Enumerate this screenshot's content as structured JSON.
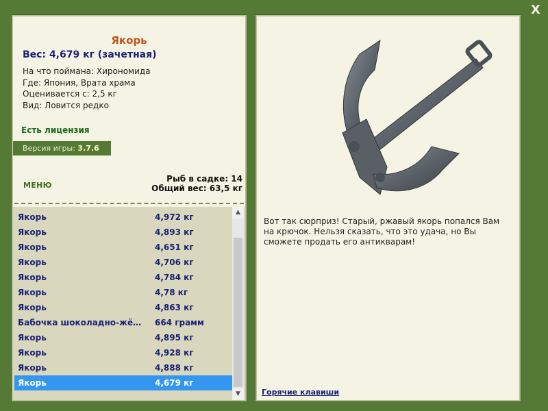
{
  "close_label": "X",
  "fish": {
    "title": "Якорь",
    "weight_line": "Вес: 4,679 кг (зачетная)",
    "info": [
      "На что поймана: Хирономида",
      "Где: Япония, Врата храма",
      "Оценивается с: 2,5 кг",
      "Вид: Ловится редко"
    ],
    "description": "Вот так сюрприз! Старый, ржавый якорь попался Вам на крючок. Нельзя сказать, что это удача, но Вы сможете продать его антикварам!",
    "image": "anchor-image"
  },
  "license": "Есть лицензия",
  "version": {
    "label": "Версия игры:",
    "value": "3.7.6"
  },
  "menu_label": "МЕНЮ",
  "stats": {
    "count": "Рыб в садке: 14",
    "total_weight": "Общий вес: 63,5 кг"
  },
  "catch_list": [
    {
      "name": "Якорь",
      "weight": "4,972 кг"
    },
    {
      "name": "Якорь",
      "weight": "4,893 кг"
    },
    {
      "name": "Якорь",
      "weight": "4,651 кг"
    },
    {
      "name": "Якорь",
      "weight": "4,706 кг"
    },
    {
      "name": "Якорь",
      "weight": "4,784 кг"
    },
    {
      "name": "Якорь",
      "weight": "4,78 кг"
    },
    {
      "name": "Якорь",
      "weight": "4,863 кг"
    },
    {
      "name": "Бабочка шоколадно-жё…",
      "weight": "664 грамм"
    },
    {
      "name": "Якорь",
      "weight": "4,895 кг"
    },
    {
      "name": "Якорь",
      "weight": "4,928 кг"
    },
    {
      "name": "Якорь",
      "weight": "4,888 кг"
    },
    {
      "name": "Якорь",
      "weight": "4,679 кг",
      "selected": true
    }
  ],
  "hotkeys_label": "Горячие клавиши",
  "colors": {
    "background": "#557a35",
    "panel": "#f5f3e3",
    "selection": "#3397f0"
  },
  "icons": {
    "scroll_up": "scroll-up-arrow-icon",
    "scroll_down": "scroll-down-arrow-icon"
  }
}
